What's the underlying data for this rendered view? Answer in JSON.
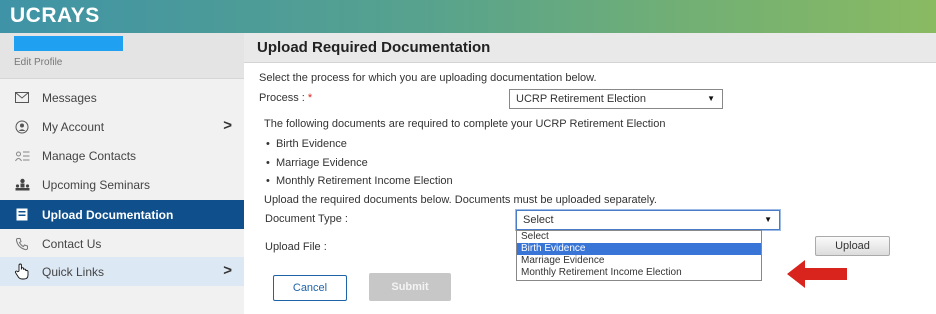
{
  "app": {
    "brand": "UCRAYS"
  },
  "profile": {
    "edit_label": "Edit Profile"
  },
  "sidebar": {
    "items": [
      {
        "label": "Messages",
        "icon": "envelope-icon"
      },
      {
        "label": "My Account",
        "icon": "account-icon",
        "chevron": ">"
      },
      {
        "label": "Manage Contacts",
        "icon": "contacts-icon"
      },
      {
        "label": "Upcoming Seminars",
        "icon": "seminars-icon"
      },
      {
        "label": "Upload Documentation",
        "icon": "upload-icon",
        "active": true
      },
      {
        "label": "Contact Us",
        "icon": "phone-icon"
      },
      {
        "label": "Quick Links",
        "icon": "hand-cursor-icon",
        "chevron": ">"
      }
    ]
  },
  "main": {
    "title": "Upload Required Documentation",
    "intro": "Select the process for which you are uploading documentation below.",
    "process_label": "Process :",
    "required_mark": "*",
    "process_value": "UCRP Retirement Election",
    "required_text": "The following documents are required to complete your UCRP Retirement Election",
    "required_docs": [
      "Birth Evidence",
      "Marriage Evidence",
      "Monthly Retirement Income Election"
    ],
    "upload_instructions": "Upload the required documents below. Documents must be uploaded separately.",
    "doc_type_label": "Document Type :",
    "doc_type_value": "Select",
    "doc_type_options": [
      "Select",
      "Birth Evidence",
      "Marriage Evidence",
      "Monthly Retirement Income Election"
    ],
    "doc_type_highlighted": "Birth Evidence",
    "upload_file_label": "Upload File :",
    "upload_button": "Upload",
    "cancel_button": "Cancel",
    "submit_button": "Submit"
  },
  "colors": {
    "active_nav": "#0f4f8c",
    "annotation_arrow": "#d9241d",
    "option_highlight": "#3875d7"
  }
}
